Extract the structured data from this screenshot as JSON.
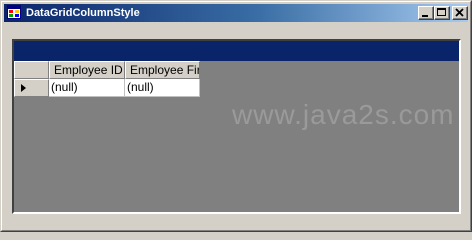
{
  "window": {
    "title": "DataGridColumnStyle"
  },
  "grid": {
    "columns": [
      "Employee ID",
      "Employee Fir"
    ],
    "rows": [
      [
        "(null)",
        "(null)"
      ]
    ]
  },
  "watermark": "www.java2s.com",
  "colors": {
    "titlebar_start": "#0a246a",
    "titlebar_end": "#a6caf0",
    "caption_bar": "#0a246a",
    "grid_background": "#808080",
    "window_face": "#d4d0c8"
  }
}
